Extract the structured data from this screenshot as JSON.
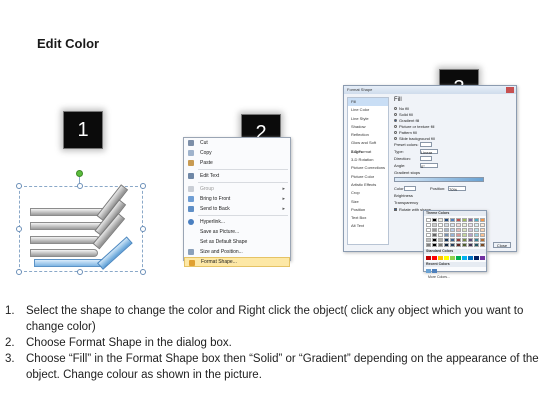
{
  "title": "Edit Color",
  "tiles": [
    "1",
    "2",
    "3"
  ],
  "context_menu": {
    "items": [
      {
        "label": "Cut",
        "icon": "scissors-icon",
        "dim": false
      },
      {
        "label": "Copy",
        "icon": "copy-icon",
        "dim": false
      },
      {
        "label": "Paste",
        "icon": "paste-icon",
        "dim": false
      },
      {
        "label": "Edit Text",
        "icon": "edit-text-icon",
        "dim": false
      },
      {
        "label": "Group",
        "icon": "group-icon",
        "dim": true
      },
      {
        "label": "Bring to Front",
        "icon": "bring-front-icon",
        "dim": false
      },
      {
        "label": "Send to Back",
        "icon": "send-back-icon",
        "dim": false
      },
      {
        "label": "Hyperlink...",
        "icon": "hyperlink-icon",
        "dim": false
      },
      {
        "label": "Save as Picture...",
        "icon": "",
        "dim": false
      },
      {
        "label": "Set as Default Shape",
        "icon": "",
        "dim": false
      },
      {
        "label": "Size and Position...",
        "icon": "size-icon",
        "dim": false
      },
      {
        "label": "Format Shape...",
        "icon": "format-shape-icon",
        "dim": false
      }
    ]
  },
  "dialog": {
    "title": "Format Shape",
    "categories": [
      "Fill",
      "Line Color",
      "Line Style",
      "Shadow",
      "Reflection",
      "Glow and Soft Edges",
      "3-D Format",
      "3-D Rotation",
      "Picture Corrections",
      "Picture Color",
      "Artistic Effects",
      "Crop",
      "Size",
      "Position",
      "Text Box",
      "Alt Text"
    ],
    "section": "Fill",
    "fill_options": [
      "No fill",
      "Solid fill",
      "Gradient fill",
      "Picture or texture fill",
      "Pattern fill",
      "Slide background fill"
    ],
    "rows": [
      "Preset colors:",
      "Type:",
      "Direction:",
      "Angle:",
      "Gradient stops"
    ],
    "type_value": "Linear",
    "angle_value": "0°",
    "color_label": "Color",
    "position_label": "Position:",
    "position_value": "70%",
    "brightness_label": "Brightness",
    "transparency_label": "Transparency",
    "rotate_label": "Rotate with shape",
    "close_label": "Close"
  },
  "palette": {
    "theme_header": "Theme Colors",
    "standard_header": "Standard Colors",
    "recent_header": "Recent Colors",
    "more_label": "More Colors...",
    "theme_top": [
      "#ffffff",
      "#000000",
      "#eeece1",
      "#1f497d",
      "#4f81bd",
      "#c0504d",
      "#9bbb59",
      "#8064a2",
      "#4bacc6",
      "#f79646"
    ],
    "standard": [
      "#c00000",
      "#ff0000",
      "#ffc000",
      "#ffff00",
      "#92d050",
      "#00b050",
      "#00b0f0",
      "#0070c0",
      "#002060",
      "#7030a0"
    ],
    "recent": [
      "#6aa2d3",
      "#4f81bd"
    ]
  },
  "steps": [
    {
      "n": "1.",
      "text": "Select the shape to change the color and Right click the object( click any object which you want to change color)"
    },
    {
      "n": "2.",
      "text": "Choose Format Shape in the dialog box."
    },
    {
      "n": "3.",
      "text": "Choose “Fill” in the Format Shape box then “Solid” or “Gradient” depending on the appearance of the object. Change colour as shown in the picture."
    }
  ]
}
